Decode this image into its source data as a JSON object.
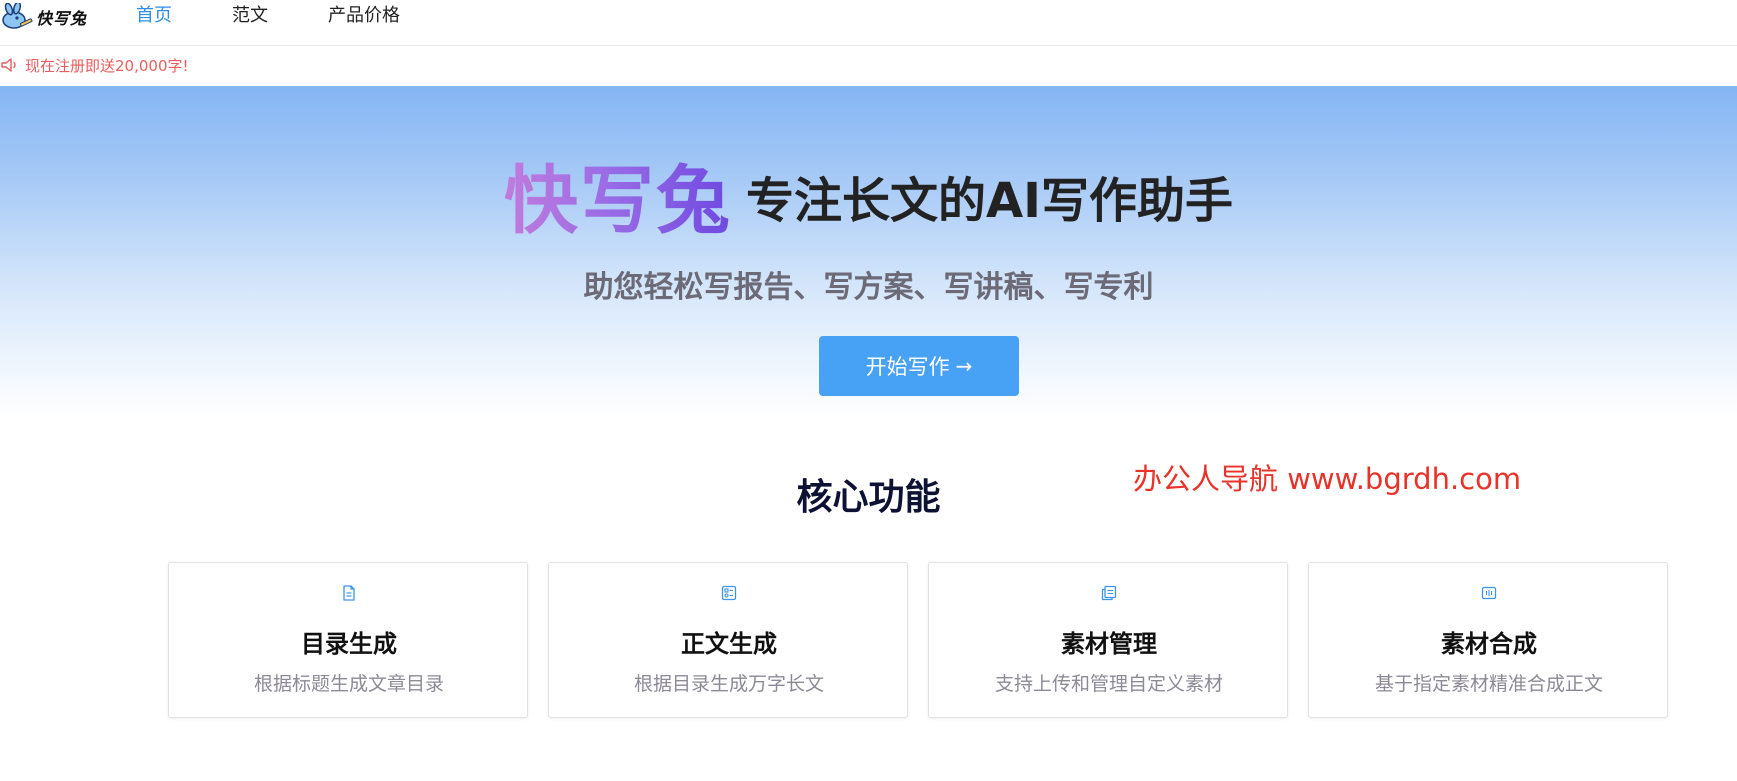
{
  "header": {
    "logo_text": "快写兔",
    "nav": [
      {
        "label": "首页",
        "active": true
      },
      {
        "label": "范文",
        "active": false
      },
      {
        "label": "产品价格",
        "active": false
      }
    ]
  },
  "notice": {
    "icon": "speaker-icon",
    "text": "现在注册即送20,000字!"
  },
  "hero": {
    "brand": "快写兔",
    "slogan": "专注长文的AI写作助手",
    "subtitle": "助您轻松写报告、写方案、写讲稿、写专利",
    "cta_label": "开始写作",
    "cta_icon": "arrow-right-icon"
  },
  "features": {
    "title": "核心功能",
    "cards": [
      {
        "icon": "document-icon",
        "title": "目录生成",
        "desc": "根据标题生成文章目录"
      },
      {
        "icon": "article-icon",
        "title": "正文生成",
        "desc": "根据目录生成万字长文"
      },
      {
        "icon": "copy-files-icon",
        "title": "素材管理",
        "desc": "支持上传和管理自定义素材"
      },
      {
        "icon": "merge-icon",
        "title": "素材合成",
        "desc": "基于指定素材精准合成正文"
      }
    ]
  },
  "watermark": "办公人导航 www.bgrdh.com",
  "colors": {
    "accent": "#47a2f6",
    "nav_active": "#2f8ee6",
    "notice": "#e85d5d",
    "watermark": "#e8322a"
  }
}
